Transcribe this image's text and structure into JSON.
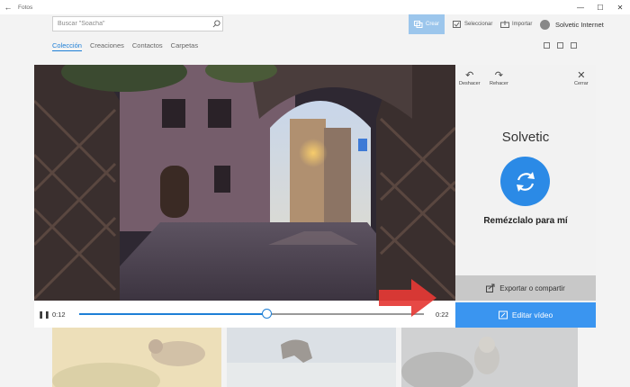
{
  "window": {
    "title": "Fotos"
  },
  "search": {
    "placeholder": "Buscar \"Soacha\""
  },
  "commands": {
    "crear": "Crear",
    "seleccionar": "Seleccionar",
    "importar": "Importar"
  },
  "user": {
    "name": "Solvetic Internet"
  },
  "nav": {
    "tabs": [
      {
        "label": "Colección"
      },
      {
        "label": "Creaciones"
      },
      {
        "label": "Contactos"
      },
      {
        "label": "Carpetas"
      }
    ]
  },
  "player": {
    "current_time": "0:12",
    "duration": "0:22",
    "progress": 0.545
  },
  "panel": {
    "undo": "Deshacer",
    "redo": "Rehacer",
    "close": "Cerrar",
    "title": "Solvetic",
    "remix_label": "Remézclalo para mí",
    "export_label": "Exportar o compartir",
    "edit_label": "Editar vídeo"
  },
  "colors": {
    "accent": "#1e7fd6",
    "edit_button": "#3a95f0",
    "remix_button": "#2b8ae6",
    "arrow": "#e53935"
  }
}
